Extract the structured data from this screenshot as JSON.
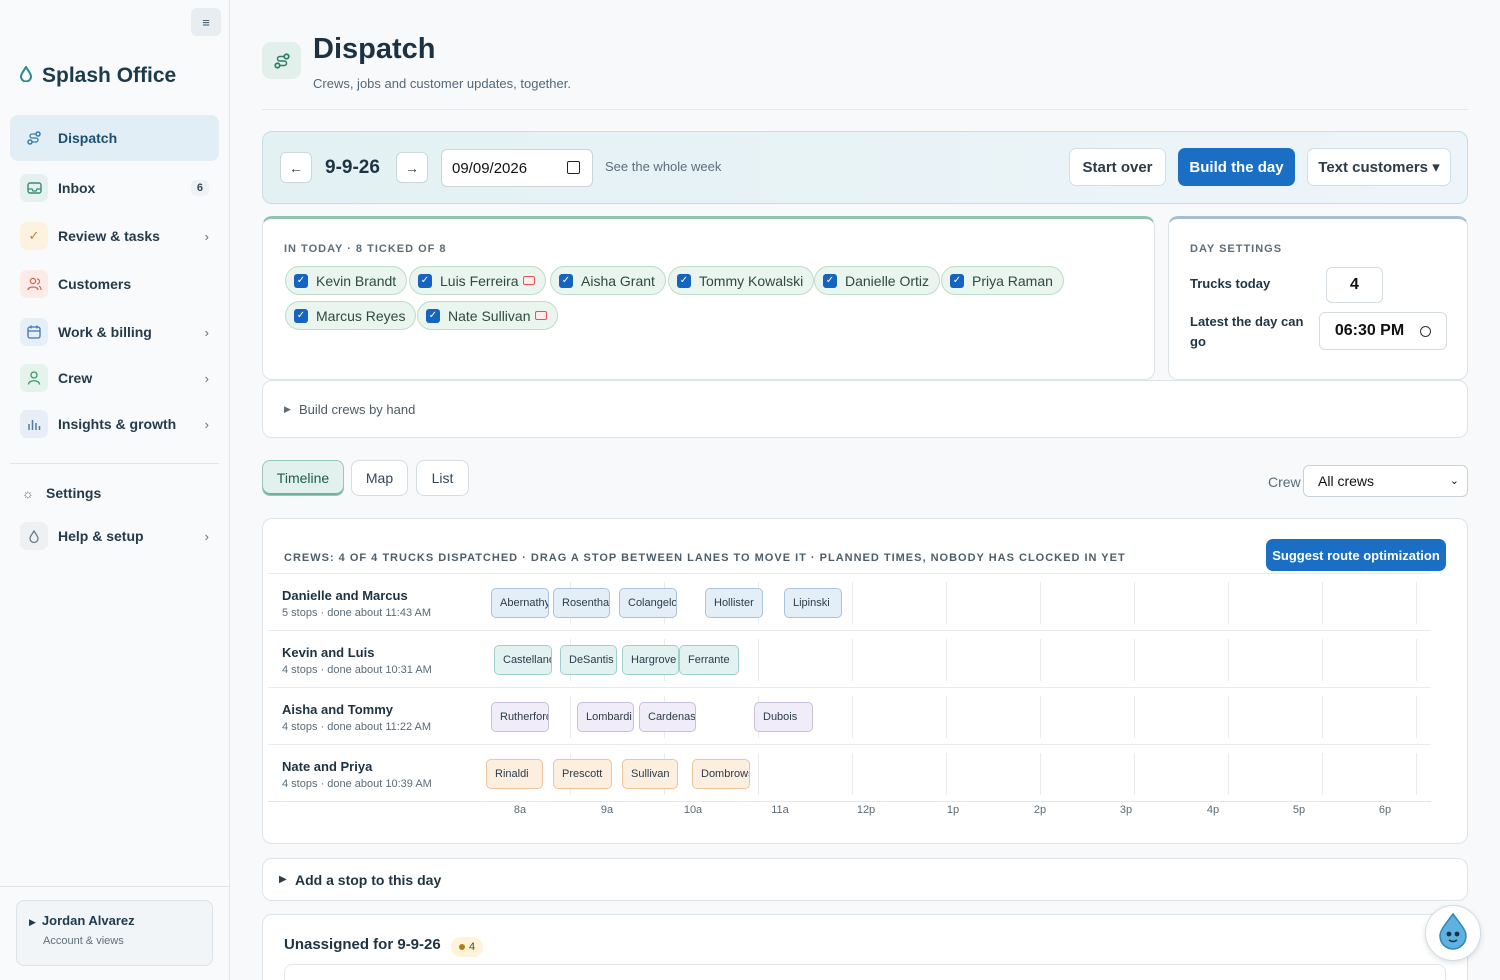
{
  "sidebar": {
    "brand": "Splash Office",
    "collapse_icon": "menu-icon",
    "items": [
      {
        "label": "Dispatch",
        "icon": "route-icon",
        "active": true
      },
      {
        "label": "Inbox",
        "icon": "inbox-icon",
        "badge": "6"
      },
      {
        "label": "Review & tasks",
        "icon": "check-icon"
      },
      {
        "label": "Customers",
        "icon": "users-icon"
      },
      {
        "label": "Work & billing",
        "icon": "calendar-icon"
      },
      {
        "label": "Crew",
        "icon": "person-icon"
      },
      {
        "label": "Insights & growth",
        "icon": "bar-chart-icon"
      },
      {
        "label": "Settings",
        "icon": "gear-icon"
      },
      {
        "label": "Help & setup",
        "icon": "drop-icon"
      }
    ],
    "account": {
      "name": "Jordan Alvarez",
      "sub": "Account & views"
    }
  },
  "header": {
    "title": "Dispatch",
    "subtitle": "Crews, jobs and customer updates, together."
  },
  "datebar": {
    "prev": "←",
    "next": "→",
    "date_label": "9-9-26",
    "date_value": "09/09/2026",
    "week_link": "See the whole week",
    "start_over": "Start over",
    "build_day": "Build the day",
    "text_customers": "Text customers ▾"
  },
  "in_today": {
    "title": "IN TODAY · 8 TICKED OF 8",
    "people": [
      {
        "name": "Kevin Brandt",
        "card": false
      },
      {
        "name": "Luis Ferreira",
        "card": true
      },
      {
        "name": "Aisha Grant",
        "card": false
      },
      {
        "name": "Tommy Kowalski",
        "card": false
      },
      {
        "name": "Danielle Ortiz",
        "card": false
      },
      {
        "name": "Priya Raman",
        "card": false
      },
      {
        "name": "Marcus Reyes",
        "card": false
      },
      {
        "name": "Nate Sullivan",
        "card": true
      }
    ]
  },
  "day_settings": {
    "title": "DAY SETTINGS",
    "trucks_label": "Trucks today",
    "trucks_value": "4",
    "latest_label": "Latest the day can go",
    "latest_value": "06:30 PM"
  },
  "build_by_hand": "Build crews by hand",
  "view_tabs": [
    {
      "label": "Timeline",
      "active": true
    },
    {
      "label": "Map"
    },
    {
      "label": "List"
    }
  ],
  "crew_filter": {
    "label": "Crew",
    "value": "All crews"
  },
  "timeline": {
    "heading": "CREWS: 4 OF 4 TRUCKS DISPATCHED · DRAG A STOP BETWEEN LANES TO MOVE IT · PLANNED TIMES, NOBODY HAS CLOCKED IN YET",
    "suggest_button": "Suggest route optimization",
    "ticks": [
      "8a",
      "9a",
      "10a",
      "11a",
      "12p",
      "1p",
      "2p",
      "3p",
      "4p",
      "5p",
      "6p"
    ],
    "lanes": [
      {
        "name": "Danielle and Marcus",
        "sub": "5 stops · done about 11:43 AM",
        "color": "blue",
        "stops": [
          "Abernathy",
          "Rosenthal",
          "Colangelo",
          "Hollister",
          "Lipinski"
        ]
      },
      {
        "name": "Kevin and Luis",
        "sub": "4 stops · done about 10:31 AM",
        "color": "teal",
        "stops": [
          "Castellano",
          "DeSantis",
          "Hargrove",
          "Ferrante"
        ]
      },
      {
        "name": "Aisha and Tommy",
        "sub": "4 stops · done about 11:22 AM",
        "color": "purple",
        "stops": [
          "Rutherford",
          "Lombardi",
          "Cardenas",
          "Dubois"
        ]
      },
      {
        "name": "Nate and Priya",
        "sub": "4 stops · done about 10:39 AM",
        "color": "orange",
        "stops": [
          "Rinaldi",
          "Prescott",
          "Sullivan",
          "Dombrowski"
        ]
      }
    ]
  },
  "add_stop": "Add a stop to this day",
  "unassigned": {
    "title": "Unassigned for 9-9-26",
    "count": "4"
  }
}
